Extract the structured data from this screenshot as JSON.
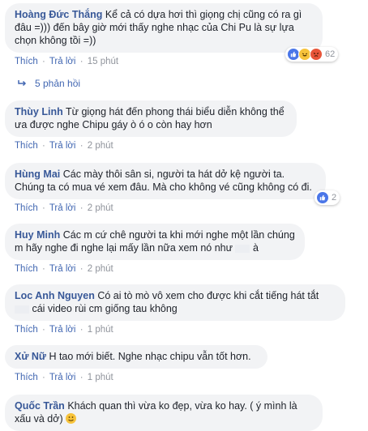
{
  "actions": {
    "like": "Thích",
    "reply": "Trả lời",
    "sep": "·"
  },
  "comments": [
    {
      "author": "Hoàng Đức Thắng",
      "text": "Kể cả có dựa hơi thì giọng chị cũng có ra gì đâu =))) đến bây giờ mới thấy nghe nhạc của Chi Pu là sự lựa chọn không tồi =))",
      "time": "15 phút",
      "reactions": "62"
    },
    {
      "author": "Thùy Linh",
      "text": "Từ giọng hát đến phong thái biểu diễn không thể ưa được nghe Chipu gáy ò ó o còn hay hơn",
      "time": "2 phút"
    },
    {
      "author": "Hùng Mai",
      "text": "Các mày thôi sân si, người ta hát dở kệ người ta. Chúng ta có mua vé xem đâu. Mà cho không vé cũng không có đi.",
      "time": "2 phút",
      "reactions": "2"
    },
    {
      "author": "Huy Minh",
      "text_a": "Các m cứ chê người ta khi mới nghe một lần chúng m hãy nghe đi nghe lại mấy lần nữa xem nó như",
      "text_b": "à",
      "time": "2 phút"
    },
    {
      "author": "Loc Anh Nguyen",
      "text_a": "Có ai tò mò vô xem cho được khi cắt tiếng hát tắt",
      "text_b": "cái video rùi cm giống tau không",
      "time": "1 phút"
    },
    {
      "author": "Xử Nữ",
      "text": "H tao mới biết. Nghe nhạc chipu vẫn tốt hơn.",
      "time": "1 phút"
    },
    {
      "author": "Quốc Trần",
      "text": "Khách quan thì vừa ko đẹp, vừa ko hay. ( ý mình là xấu và dở)"
    }
  ],
  "replies_label": "5 phản hồi",
  "colors": {
    "author": "#385898",
    "bubble": "#f2f3f5",
    "meta": "#90949c",
    "link": "#4267b2"
  },
  "icons": {
    "like": "like-icon",
    "haha": "haha-icon",
    "angry": "angry-icon",
    "reply_arrow": "reply-arrow-icon",
    "emoji": "smile-emoji"
  }
}
